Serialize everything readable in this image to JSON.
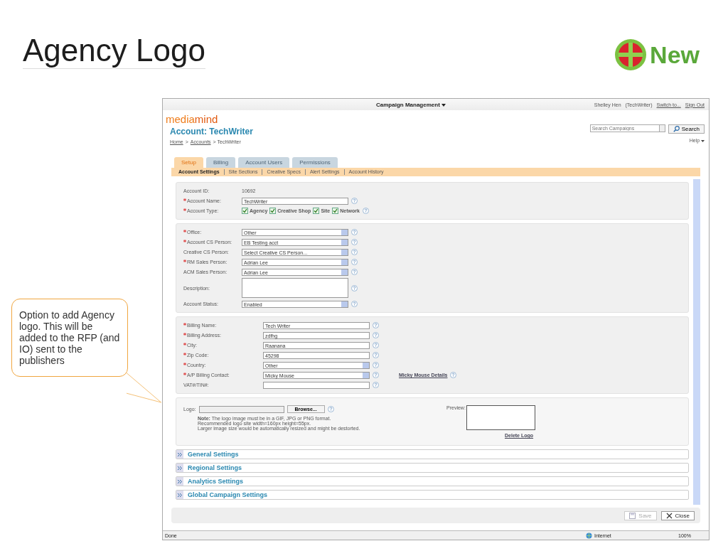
{
  "slide": {
    "title": "Agency Logo",
    "badge": "New",
    "callout": "Option to add Agency logo. This will be added to the RFP (and IO) sent to the publishers"
  },
  "app": {
    "top_menu": "Campaign Management",
    "user": "Shelley Hen",
    "account": "(TechWriter)",
    "switch_link": "Switch to...",
    "sign_out": "Sign Out",
    "logo": {
      "part_1": "media",
      "part_2": "mind"
    },
    "title": "Account: TechWriter",
    "breadcrumb": [
      {
        "label": "Home",
        "kind": "link"
      },
      {
        "label": ">",
        "kind": "sep"
      },
      {
        "label": "Accounts",
        "kind": "link"
      },
      {
        "label": "> TechWriter",
        "kind": "text"
      }
    ],
    "search": {
      "placeholder": "Search Campaigns",
      "button": "Search"
    },
    "help": "Help",
    "tabs": [
      {
        "label": "Setup",
        "selected": true
      },
      {
        "label": "Billing",
        "selected": false
      },
      {
        "label": "Account Users",
        "selected": false
      },
      {
        "label": "Permissions",
        "selected": false
      }
    ],
    "subnav": [
      {
        "label": "Account Settings",
        "selected": true
      },
      {
        "label": "Site Sections",
        "selected": false
      },
      {
        "label": "Creative Specs",
        "selected": false
      },
      {
        "label": "Alert Settings",
        "selected": false
      },
      {
        "label": "Account History",
        "selected": false
      }
    ],
    "sections": [
      {
        "kind": "form",
        "fields": [
          {
            "label": "Account ID:",
            "required": false,
            "kind": "value",
            "value": "10692"
          },
          {
            "label": "Account Name:",
            "required": true,
            "kind": "text",
            "value": "TechWriter"
          },
          {
            "label": "Account Type:",
            "required": true,
            "kind": "checkboxes",
            "options": [
              {
                "label": "Agency",
                "checked": true
              },
              {
                "label": "Creative Shop",
                "checked": true
              },
              {
                "label": "Site",
                "checked": true
              },
              {
                "label": "Network",
                "checked": true
              }
            ]
          }
        ]
      },
      {
        "kind": "form",
        "fields": [
          {
            "label": "Office:",
            "required": true,
            "kind": "select",
            "value": "Other"
          },
          {
            "label": "Account CS Person:",
            "required": true,
            "kind": "select",
            "value": "EB Testing acct"
          },
          {
            "label": "Creative CS Person:",
            "required": false,
            "kind": "select",
            "value": "Select Creative CS Person..."
          },
          {
            "label": "RM Sales Person:",
            "required": true,
            "kind": "select",
            "value": "Adrian Lee"
          },
          {
            "label": "ACM Sales Person:",
            "required": false,
            "kind": "select",
            "value": "Adrian Lee"
          },
          {
            "label": "Description:",
            "required": false,
            "kind": "textarea"
          },
          {
            "label": "Account Status:",
            "required": false,
            "kind": "select",
            "value": "Enabled"
          }
        ]
      },
      {
        "kind": "billing",
        "fields": [
          {
            "label": "Billing Name:",
            "required": true,
            "kind": "text",
            "value": "Tech Writer"
          },
          {
            "label": "Billing Address:",
            "required": true,
            "kind": "text",
            "value": "zdfhg"
          },
          {
            "label": "City:",
            "required": true,
            "kind": "text",
            "value": "Raanana"
          },
          {
            "label": "Zip Code:",
            "required": true,
            "kind": "text",
            "value": "45298"
          },
          {
            "label": "Country:",
            "required": true,
            "kind": "select",
            "value": "Other"
          },
          {
            "label": "A/P Billing Contact:",
            "required": true,
            "kind": "select",
            "value": "Micky Mouse",
            "link": "Micky Mouse Details"
          },
          {
            "label": "VAT#/TIN#:",
            "required": false,
            "kind": "text"
          }
        ]
      }
    ],
    "logo_section": {
      "label": "Logo:",
      "browse": "Browse...",
      "notes": [
        "**Note:** The logo image must be in a GIF, JPG or PNG format.",
        "Recommended logo site width=160px height=55px.",
        "Larger image size would be automatically resized and might be destorted."
      ],
      "preview": "Preview:",
      "delete": "Delete Logo"
    },
    "collapsibles": [
      "General Settings",
      "Regional Settings",
      "Analytics Settings",
      "Global Campaign Settings"
    ],
    "buttons": [
      {
        "label": "Save",
        "disabled": true,
        "kind": "save"
      },
      {
        "label": "Close",
        "disabled": false,
        "kind": "close"
      }
    ],
    "status_bar": {
      "text": "Done",
      "zone": "Internet",
      "zoom": "100%"
    }
  }
}
